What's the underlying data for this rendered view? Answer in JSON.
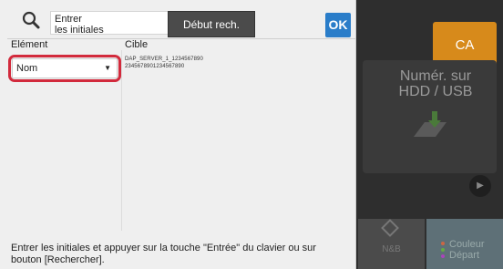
{
  "background": {
    "ca_label": "CA",
    "scan_card_label": "Numér. sur HDD / USB",
    "stop_label": "N&B",
    "color_start_label": "Couleur\nDépart",
    "colors": {
      "ca": "#d78a1b",
      "color_start": "#5e7077"
    }
  },
  "dialog": {
    "search_icon": "search-icon",
    "initials_field": {
      "value": "Entrer\nles initiales"
    },
    "start_search_label": "Début rech.",
    "ok_label": "OK",
    "columns": {
      "element": "Elément",
      "target": "Cible"
    },
    "element_select": {
      "selected": "Nom"
    },
    "target_lines": [
      "DAP_SERVER_1_1234567890",
      "2345678901234567890"
    ],
    "hint": "Entrer les initiales et appuyer sur la touche \"Entrée\" du clavier ou sur bouton [Rechercher].",
    "colors": {
      "ok": "#2a7dc9",
      "highlight": "#d22a3c"
    }
  }
}
